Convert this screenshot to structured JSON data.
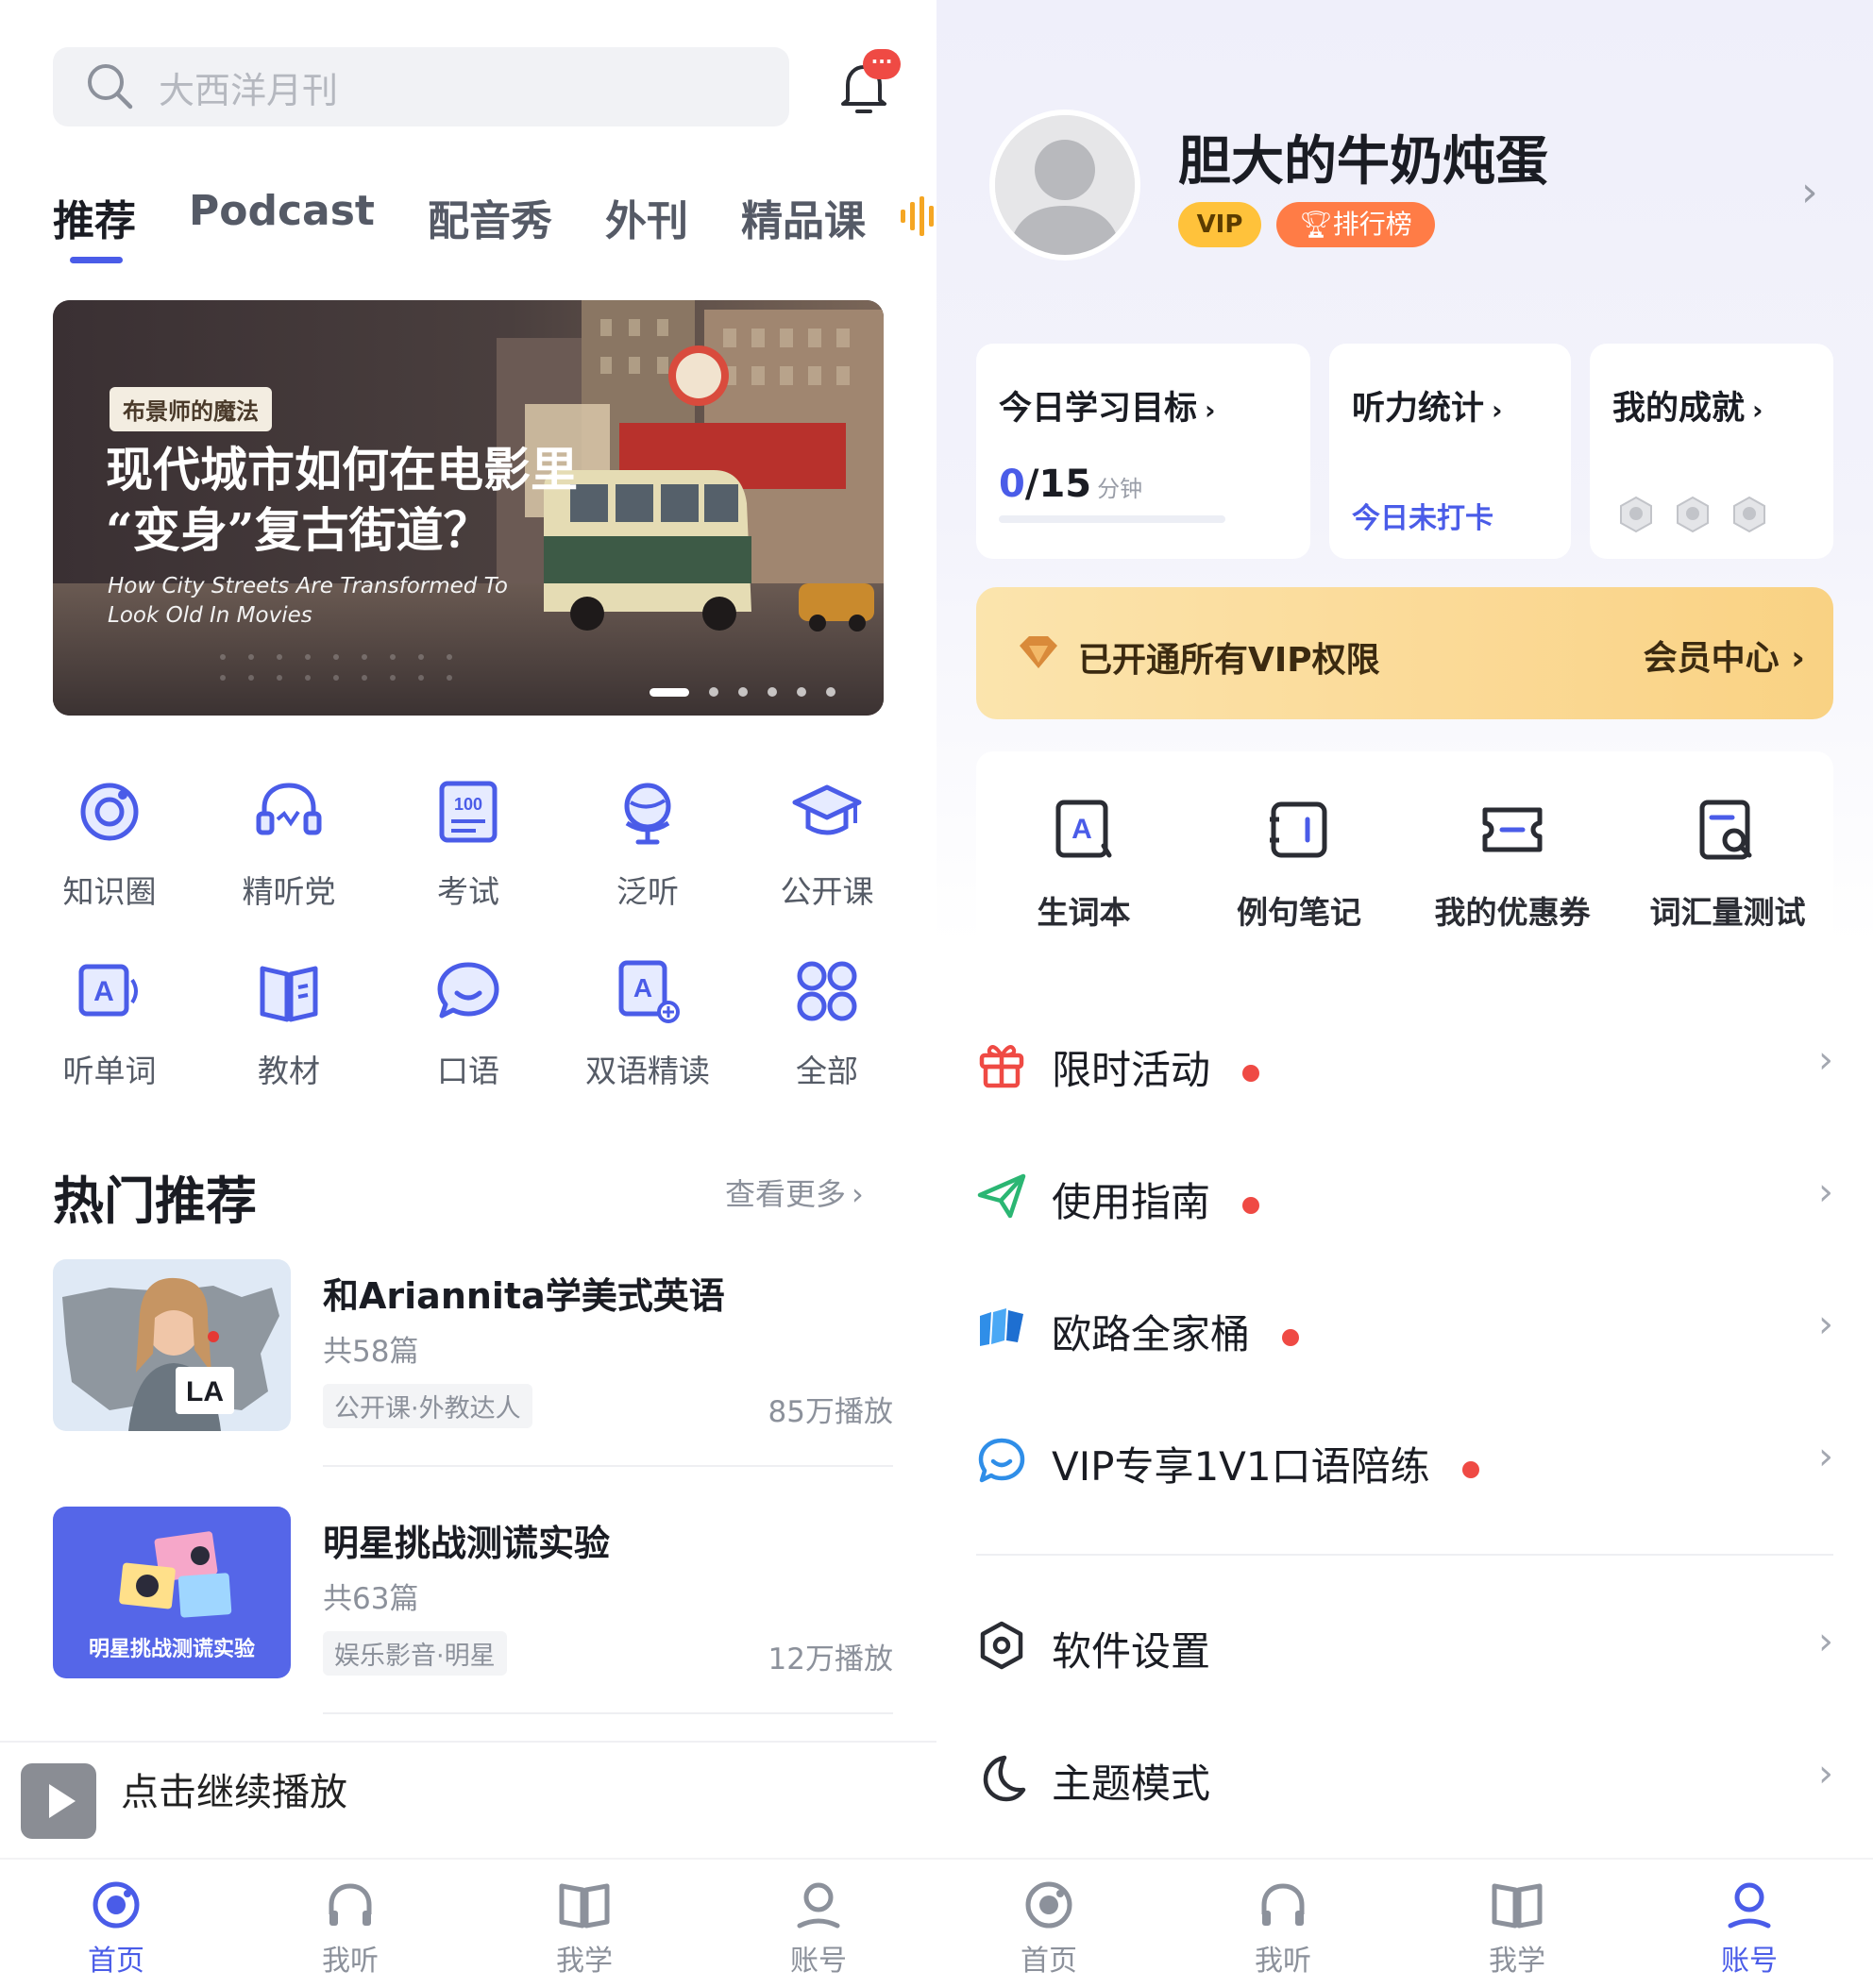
{
  "home": {
    "search": {
      "placeholder": "大西洋月刊"
    },
    "notification": {
      "badge": "···"
    },
    "tabs": [
      {
        "label": "推荐",
        "active": true
      },
      {
        "label": "Podcast",
        "active": false
      },
      {
        "label": "配音秀",
        "active": false
      },
      {
        "label": "外刊",
        "active": false
      },
      {
        "label": "精品课",
        "active": false
      }
    ],
    "banner": {
      "tag": "布景师的魔法",
      "title_line1": "现代城市如何在电影里",
      "title_line2": "“变身”复古街道？",
      "subtitle_line1": "How City Streets Are Transformed To",
      "subtitle_line2": "Look Old In Movies",
      "page_count": 6,
      "current_page": 1
    },
    "features": [
      {
        "label": "知识圈",
        "icon": "circle-target-icon"
      },
      {
        "label": "精听党",
        "icon": "headset-icon"
      },
      {
        "label": "考试",
        "icon": "exam-100-icon"
      },
      {
        "label": "泛听",
        "icon": "globe-icon"
      },
      {
        "label": "公开课",
        "icon": "graduation-cap-icon"
      },
      {
        "label": "听单词",
        "icon": "word-audio-icon"
      },
      {
        "label": "教材",
        "icon": "book-icon"
      },
      {
        "label": "口语",
        "icon": "chat-bubble-icon"
      },
      {
        "label": "双语精读",
        "icon": "bilingual-read-icon"
      },
      {
        "label": "全部",
        "icon": "grid-all-icon"
      }
    ],
    "hot": {
      "title": "热门推荐",
      "see_more": "查看更多",
      "courses": [
        {
          "title": "和Ariannita学美式英语",
          "count": "共58篇",
          "tag": "公开课·外教达人",
          "plays": "85万播放",
          "thumb_text": "LA"
        },
        {
          "title": "明星挑战测谎实验",
          "count": "共63篇",
          "tag": "娱乐影音·明星",
          "plays": "12万播放",
          "thumb_text": "明星挑战测谎实验"
        }
      ]
    },
    "player": {
      "label": "点击继续播放"
    }
  },
  "account": {
    "username": "胆大的牛奶炖蛋",
    "vip_badge": "VIP",
    "rank_badge": "排行榜",
    "cards": {
      "goal": {
        "title": "今日学习目标",
        "current": "0",
        "total": "/15",
        "unit": "分钟",
        "progress": 0
      },
      "listening": {
        "title": "听力统计",
        "status": "今日未打卡"
      },
      "achievement": {
        "title": "我的成就",
        "badge_count": 3
      }
    },
    "vip_bar": {
      "text": "已开通所有VIP权限",
      "center": "会员中心"
    },
    "tools": [
      {
        "label": "生词本",
        "icon": "vocabulary-book-icon"
      },
      {
        "label": "例句笔记",
        "icon": "sentence-notes-icon"
      },
      {
        "label": "我的优惠券",
        "icon": "coupon-icon"
      },
      {
        "label": "词汇量测试",
        "icon": "vocabulary-test-icon"
      }
    ],
    "menu": [
      {
        "label": "限时活动",
        "icon": "gift-icon",
        "dot": true
      },
      {
        "label": "使用指南",
        "icon": "paper-plane-icon",
        "dot": true
      },
      {
        "label": "欧路全家桶",
        "icon": "eudic-apps-icon",
        "dot": true
      },
      {
        "label": "VIP专享1V1口语陪练",
        "icon": "chat-bubble-icon",
        "dot": true
      }
    ],
    "settings": [
      {
        "label": "软件设置",
        "icon": "settings-hexagon-icon"
      },
      {
        "label": "主题模式",
        "icon": "moon-icon"
      }
    ]
  },
  "tabbar": {
    "items": [
      {
        "label": "首页",
        "icon": "home-icon"
      },
      {
        "label": "我听",
        "icon": "headphones-icon"
      },
      {
        "label": "我学",
        "icon": "open-book-icon"
      },
      {
        "label": "账号",
        "icon": "account-icon"
      }
    ],
    "active_left": 0,
    "active_right": 3
  },
  "colors": {
    "accent": "#4a5ce8",
    "red_dot": "#ef4a44",
    "vip_gold": "#ffc23b",
    "rank_orange": "#ff7c46"
  }
}
